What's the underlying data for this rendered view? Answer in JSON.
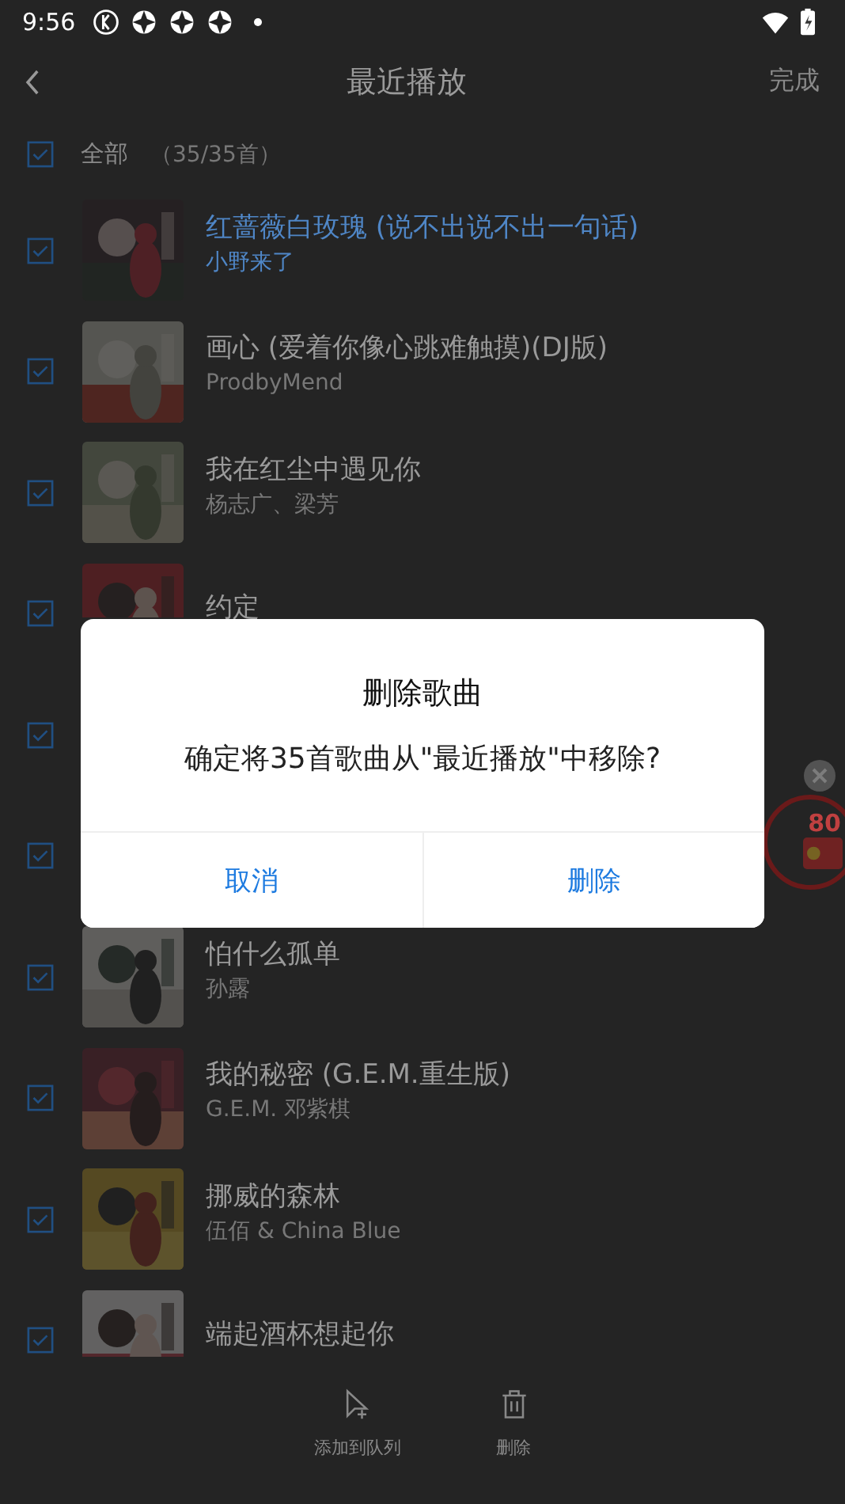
{
  "status_bar": {
    "time": "9:56"
  },
  "header": {
    "title": "最近播放",
    "action": "完成"
  },
  "select_all": {
    "label": "全部",
    "count": "（35/35首）",
    "checked": true
  },
  "songs": [
    {
      "title": "红蔷薇白玫瑰 (说不出说不出一句话)",
      "artist": "小野来了",
      "checked": true,
      "playing": true
    },
    {
      "title": "画心 (爱着你像心跳难触摸)(DJ版)",
      "artist": "ProdbyMend",
      "checked": true,
      "playing": false
    },
    {
      "title": "我在红尘中遇见你",
      "artist": "杨志广、梁芳",
      "checked": true,
      "playing": false
    },
    {
      "title": "约定",
      "checked": true,
      "playing": false
    },
    {
      "checked": true
    },
    {
      "checked": true
    },
    {
      "title": "怕什么孤单",
      "artist": "孙露",
      "checked": true,
      "playing": false
    },
    {
      "title": "我的秘密 (G.E.M.重生版)",
      "artist": "G.E.M. 邓紫棋",
      "checked": true,
      "playing": false
    },
    {
      "title": "挪威的森林",
      "artist": "伍佰 & China Blue",
      "checked": true,
      "playing": false
    },
    {
      "title": "端起酒杯想起你",
      "checked": true,
      "playing": false
    }
  ],
  "floating_badge": {
    "count": "80"
  },
  "bottom_actions": [
    {
      "kind": "queue",
      "label": "添加到队列"
    },
    {
      "kind": "delete",
      "label": "删除"
    }
  ],
  "dialog": {
    "title": "删除歌曲",
    "message": "确定将35首歌曲从\"最近播放\"中移除?",
    "buttons": [
      "取消",
      "删除"
    ]
  }
}
